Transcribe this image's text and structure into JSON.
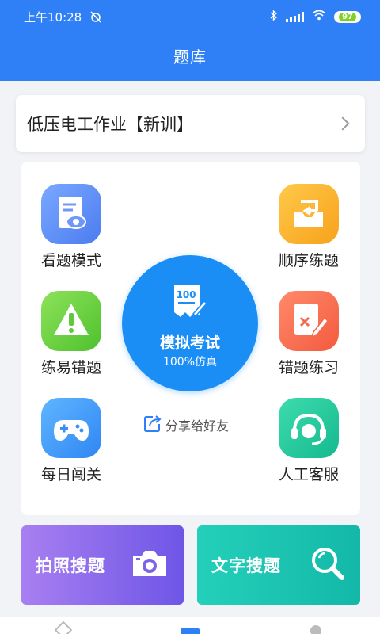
{
  "status": {
    "time": "上午10:28",
    "battery": "97"
  },
  "header": {
    "title": "题库"
  },
  "course": {
    "name": "低压电工作业【新训】"
  },
  "features": {
    "view_mode": "看题模式",
    "sequence": "顺序练题",
    "easy_wrong": "练易错题",
    "wrong_practice": "错题练习",
    "daily": "每日闯关",
    "service": "人工客服"
  },
  "exam": {
    "paper_score": "100",
    "label": "模拟考试",
    "sub": "100%仿真"
  },
  "share": {
    "label": "分享给好友"
  },
  "search": {
    "photo_label": "拍照搜题",
    "text_label": "文字搜题"
  },
  "colors": {
    "brand": "#2f80f6",
    "exam": "#1a8ef5",
    "photo": "#8b6bee",
    "text": "#1cc4b0"
  }
}
